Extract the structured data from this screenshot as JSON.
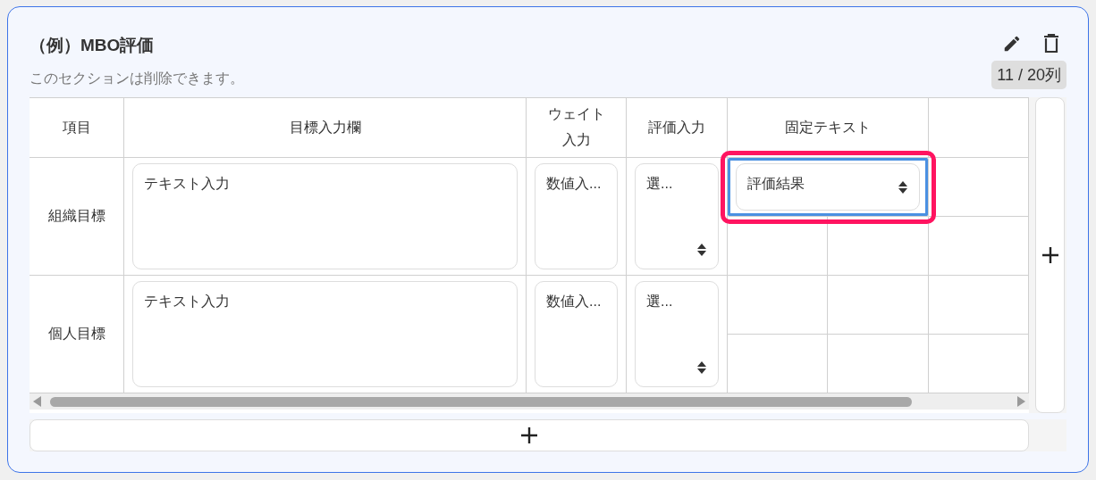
{
  "section": {
    "title": "（例）MBO評価",
    "description": "このセクションは削除できます。",
    "column_count": "11 / 20列"
  },
  "table": {
    "columns": [
      "項目",
      "目標入力欄",
      "ウェイト入力",
      "評価入力",
      "固定テキスト"
    ],
    "rows": [
      {
        "label": "組織目標",
        "text_placeholder": "テキスト入力",
        "number_placeholder": "数値入...",
        "select_placeholder": "選...",
        "fixed_select": {
          "value": "評価結果",
          "selected": true
        }
      },
      {
        "label": "個人目標",
        "text_placeholder": "テキスト入力",
        "number_placeholder": "数値入...",
        "select_placeholder": "選..."
      }
    ]
  }
}
